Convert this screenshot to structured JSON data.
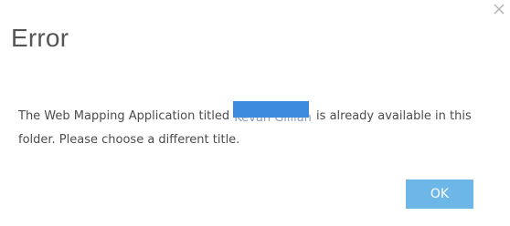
{
  "dialog": {
    "title": "Error",
    "message_before": "The Web Mapping Application titled ",
    "redacted_title": "Kevan Gillian",
    "message_after": " is already available in this folder. Please choose a different title.",
    "close_icon": "close-icon",
    "ok_label": "OK",
    "accent_color": "#6db6e8",
    "redaction_color": "#3d8bde"
  }
}
